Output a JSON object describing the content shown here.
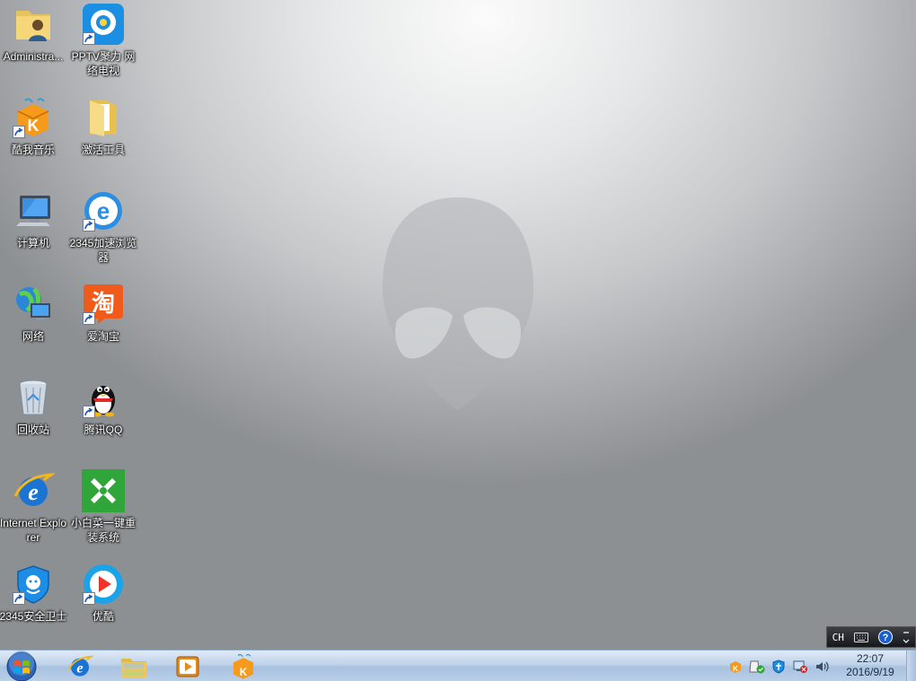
{
  "desktop": {
    "icons": [
      {
        "label": "Administra...",
        "icon": "user-folder-icon"
      },
      {
        "label": "PPTV聚力 网络电视",
        "icon": "pptv-icon"
      },
      {
        "label": "酷我音乐",
        "icon": "kuwo-music-icon"
      },
      {
        "label": "激活工具",
        "icon": "folder-icon"
      },
      {
        "label": "计算机",
        "icon": "computer-icon"
      },
      {
        "label": "2345加速浏览器",
        "icon": "browser-2345-icon"
      },
      {
        "label": "网络",
        "icon": "network-icon"
      },
      {
        "label": "爱淘宝",
        "icon": "taobao-icon"
      },
      {
        "label": "回收站",
        "icon": "recycle-bin-icon"
      },
      {
        "label": "腾讯QQ",
        "icon": "qq-penguin-icon"
      },
      {
        "label": "Internet Explorer",
        "icon": "ie-icon"
      },
      {
        "label": "小白菜一键重装系统",
        "icon": "xiaobaicai-icon"
      },
      {
        "label": "2345安全卫士",
        "icon": "security-2345-icon"
      },
      {
        "label": "优酷",
        "icon": "youku-icon"
      }
    ]
  },
  "langbar": {
    "lang": "CH",
    "keyboard_icon": "keyboard-icon",
    "help_icon": "help-icon"
  },
  "taskbar": {
    "pinned": [
      {
        "name": "taskbar-ie",
        "icon": "ie-icon"
      },
      {
        "name": "taskbar-explorer",
        "icon": "explorer-folder-icon"
      },
      {
        "name": "taskbar-media-player",
        "icon": "media-player-icon"
      },
      {
        "name": "taskbar-kuwo",
        "icon": "kuwo-music-icon"
      }
    ],
    "tray_icons": [
      "kuwo-tray-icon",
      "action-center-icon",
      "shield-tray-icon",
      "network-disconnected-icon",
      "volume-icon"
    ],
    "clock": {
      "time": "22:07",
      "date": "2016/9/19"
    }
  },
  "colors": {
    "taskbar": "#bfd3ea",
    "ie_blue": "#1b74d1",
    "youku_blue": "#1aa3e8",
    "taobao_orange": "#f05a1a",
    "xiaobaicai_green": "#2fa53a"
  }
}
